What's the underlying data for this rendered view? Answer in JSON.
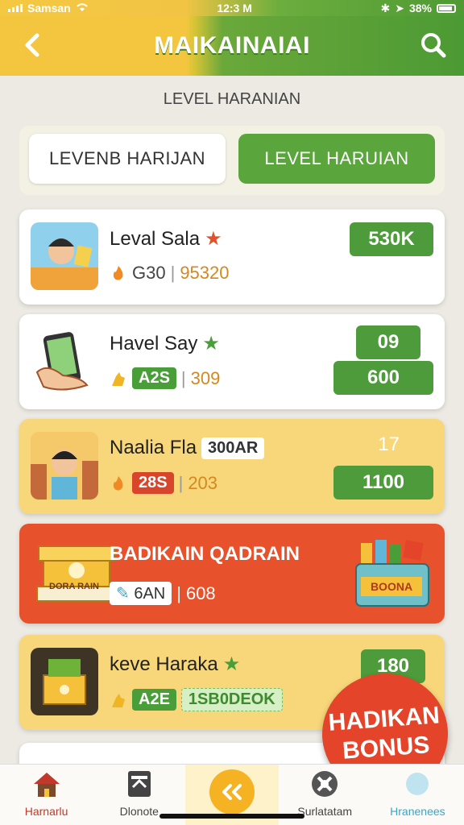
{
  "status_bar": {
    "carrier": "Samsan",
    "time": "12:3 M",
    "battery": "38%"
  },
  "header": {
    "title": "MAIKAINAIAI"
  },
  "subtitle": "LEVEL HARANIAN",
  "tabs": [
    {
      "label": "LEVENB HARIJAN",
      "active": false
    },
    {
      "label": "LEVEL HARUIAN",
      "active": true
    }
  ],
  "cards": [
    {
      "name": "Leval Sala",
      "meta_value": "G30",
      "meta_right": "95320",
      "pill": "530K"
    },
    {
      "name": "Havel Say",
      "chip": "A2S",
      "meta_right": "309",
      "top_value": "09",
      "pill": "600"
    },
    {
      "name": "Naalia Fla",
      "name_chip": "300AR",
      "chip": "28S",
      "meta_right": "203",
      "top_value": "17",
      "pill": "1100"
    },
    {
      "name": "BADIKAIN QADRAIN",
      "chip": "6AN",
      "meta_right": "608",
      "badge_left": "DORA RAIN",
      "badge_right": "BOONA"
    },
    {
      "name": "keve Haraka",
      "chip": "A2E",
      "chip2": "1SB0DEOK",
      "pill": "180"
    }
  ],
  "bonus": {
    "line1": "HADIKAN",
    "line2": "BONUS"
  },
  "tabbar": [
    {
      "label": "Harnarlu"
    },
    {
      "label": "Dlonote"
    },
    {
      "label": ""
    },
    {
      "label": "Surlatatam"
    },
    {
      "label": "Hranenees"
    }
  ],
  "colors": {
    "green": "#4d9b3a",
    "yellow": "#f4c63f",
    "orange": "#e7512b"
  }
}
